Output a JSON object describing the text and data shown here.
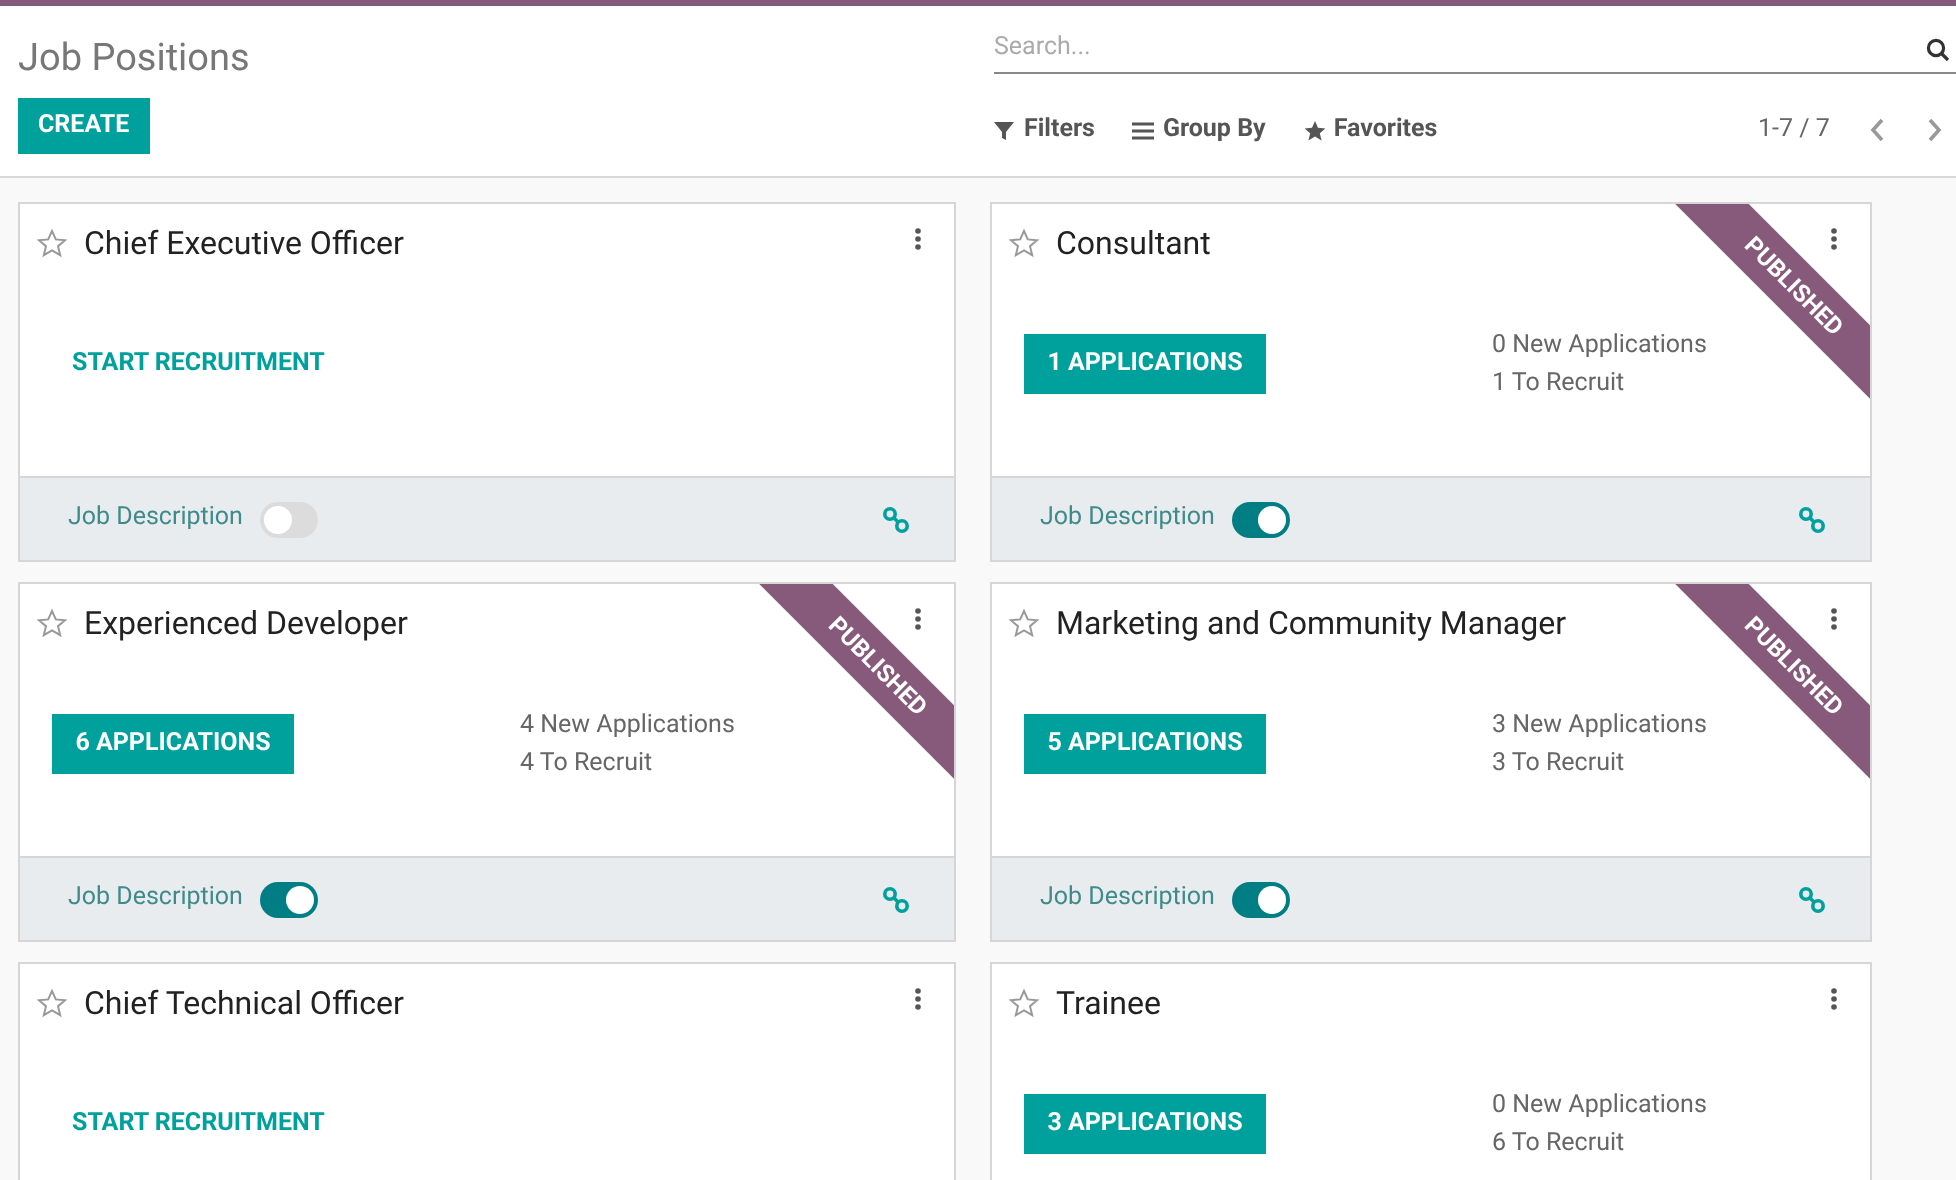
{
  "title": "Job Positions",
  "create_button": "CREATE",
  "search": {
    "placeholder": "Search..."
  },
  "filters": [
    {
      "kind": "filter",
      "label": "Filters"
    },
    {
      "kind": "group",
      "label": "Group By"
    },
    {
      "kind": "favorite",
      "label": "Favorites"
    }
  ],
  "pager": "1-7 / 7",
  "cards": [
    {
      "title": "Chief Executive Officer",
      "published": false,
      "kind": "recruit",
      "action": "START RECRUITMENT",
      "footer": {
        "label": "Job Description",
        "on": false
      }
    },
    {
      "title": "Consultant",
      "published": true,
      "ribbon": "PUBLISHED",
      "kind": "applications",
      "action": "1 APPLICATIONS",
      "new": "0 New Applications",
      "to_recruit": "1 To Recruit",
      "footer": {
        "label": "Job Description",
        "on": true
      }
    },
    {
      "title": "Experienced Developer",
      "published": true,
      "ribbon": "PUBLISHED",
      "kind": "applications",
      "action": "6 APPLICATIONS",
      "new": "4 New Applications",
      "to_recruit": "4 To Recruit",
      "footer": {
        "label": "Job Description",
        "on": true
      }
    },
    {
      "title": "Marketing and Community Manager",
      "published": true,
      "ribbon": "PUBLISHED",
      "kind": "applications",
      "action": "5 APPLICATIONS",
      "new": "3 New Applications",
      "to_recruit": "3 To Recruit",
      "footer": {
        "label": "Job Description",
        "on": true
      }
    },
    {
      "title": "Chief Technical Officer",
      "published": false,
      "kind": "recruit",
      "action": "START RECRUITMENT"
    },
    {
      "title": "Trainee",
      "published": false,
      "kind": "applications",
      "action": "3 APPLICATIONS",
      "new": "0 New Applications",
      "to_recruit": "6 To Recruit"
    }
  ]
}
